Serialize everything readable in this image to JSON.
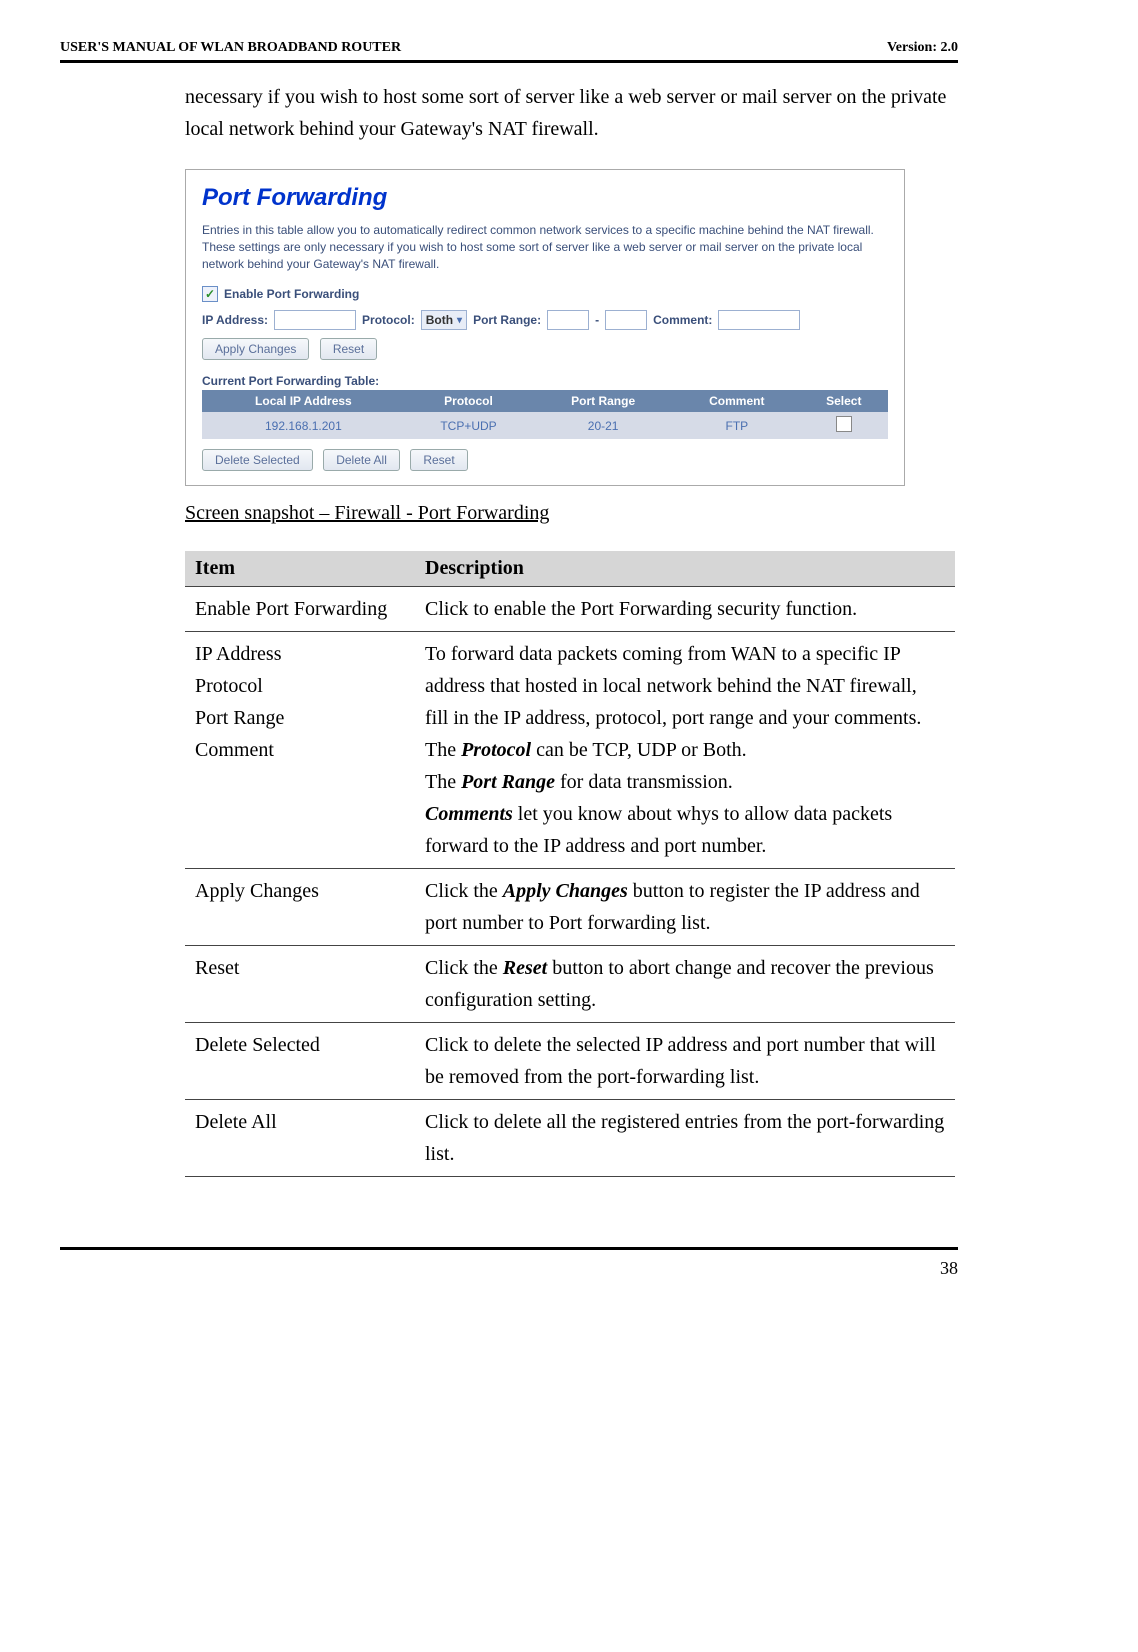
{
  "header": {
    "left": "USER'S MANUAL OF WLAN BROADBAND ROUTER",
    "right": "Version: 2.0"
  },
  "intro": "necessary if you wish to host some sort of server like a web server or mail server on the private local network behind your Gateway's NAT firewall.",
  "screenshot": {
    "title": "Port Forwarding",
    "description": "Entries in this table allow you to automatically redirect common network services to a specific machine behind the NAT firewall. These settings are only necessary if you wish to host some sort of server like a web server or mail server on the private local network behind your Gateway's NAT firewall.",
    "enable_label": "Enable Port Forwarding",
    "ip_label": "IP Address:",
    "protocol_label": "Protocol:",
    "protocol_value": "Both",
    "port_range_label": "Port Range:",
    "comment_label": "Comment:",
    "apply_btn": "Apply Changes",
    "reset_btn": "Reset",
    "table_title": "Current Port Forwarding Table:",
    "headers": [
      "Local IP Address",
      "Protocol",
      "Port Range",
      "Comment",
      "Select"
    ],
    "row": {
      "ip": "192.168.1.201",
      "protocol": "TCP+UDP",
      "port": "20-21",
      "comment": "FTP"
    },
    "delete_selected": "Delete Selected",
    "delete_all": "Delete All",
    "reset2": "Reset"
  },
  "caption": "Screen snapshot – Firewall - Port Forwarding",
  "table": {
    "h1": "Item",
    "h2": "Description",
    "rows": [
      {
        "item": "Enable Port Forwarding",
        "desc": "Click to enable the Port Forwarding security function."
      },
      {
        "item_html": "IP Address<br>Protocol<br>Port Range<br>Comment",
        "desc_html": "To forward data packets coming from WAN to a specific IP address that hosted in local network behind the NAT firewall, fill in the IP address, protocol, port range and your comments.<br>The <b><i>Protocol</i></b> can be TCP, UDP or Both.<br>The <b><i>Port Range</i></b> for data transmission.<br><b><i>Comments</i></b> let you know about whys to allow data packets forward to the IP address and port number."
      },
      {
        "item": "Apply Changes",
        "desc_html": "Click the <b><i>Apply Changes</i></b> button to register the IP address and port number to Port forwarding list."
      },
      {
        "item": "Reset",
        "desc_html": "Click the <b><i>Reset</i></b> button to abort change and recover the previous configuration setting."
      },
      {
        "item": "Delete Selected",
        "desc": "Click to delete the selected IP address and port number that will be removed from the port-forwarding list."
      },
      {
        "item": "Delete All",
        "desc": "Click to delete all the registered entries from the port-forwarding list."
      }
    ]
  },
  "page_num": "38"
}
